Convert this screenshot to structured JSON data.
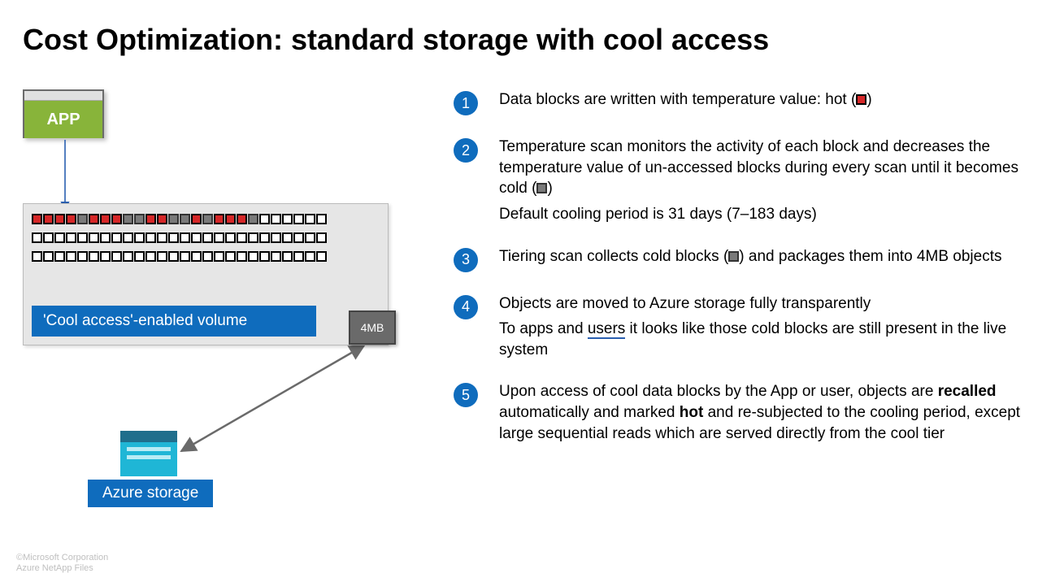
{
  "title": "Cost Optimization: standard storage with cool access",
  "app_label": "APP",
  "volume_label": "'Cool access'-enabled volume",
  "object_label": "4MB",
  "storage_label": "Azure storage",
  "row1_states": [
    "hot",
    "hot",
    "hot",
    "hot",
    "cold",
    "hot",
    "hot",
    "hot",
    "cold",
    "cold",
    "hot",
    "hot",
    "cold",
    "cold",
    "hot",
    "cold",
    "hot",
    "hot",
    "hot",
    "cold",
    "",
    "",
    "",
    "",
    "",
    ""
  ],
  "row2_count": 26,
  "row3_count": 26,
  "steps": [
    {
      "num": "1",
      "text": "Data blocks are written with temperature value: hot (",
      "swatch": "hot",
      "text_after": ")"
    },
    {
      "num": "2",
      "text": "Temperature scan monitors the activity of each block and decreases the temperature value of un-accessed blocks during every scan until it becomes cold (",
      "swatch": "cold",
      "text_after": ")",
      "sub": "Default cooling period is 31 days (7–183 days)"
    },
    {
      "num": "3",
      "text": "Tiering scan collects cold blocks (",
      "swatch": "cold",
      "text_after": ") and packages them into 4MB objects"
    },
    {
      "num": "4",
      "text_plain": "Objects are moved to Azure storage fully transparently",
      "sub_html": "To apps and <span class='underline'>users</span> it looks like those cold blocks are still present in the live system"
    },
    {
      "num": "5",
      "text_html": "Upon access of cool data blocks by the App or user, objects are <b>recalled</b> automatically and marked <b>hot</b> and re-subjected to the cooling period, except large sequential reads which are served directly from the cool tier"
    }
  ],
  "footer_line1": "©Microsoft Corporation",
  "footer_line2": "Azure NetApp Files"
}
